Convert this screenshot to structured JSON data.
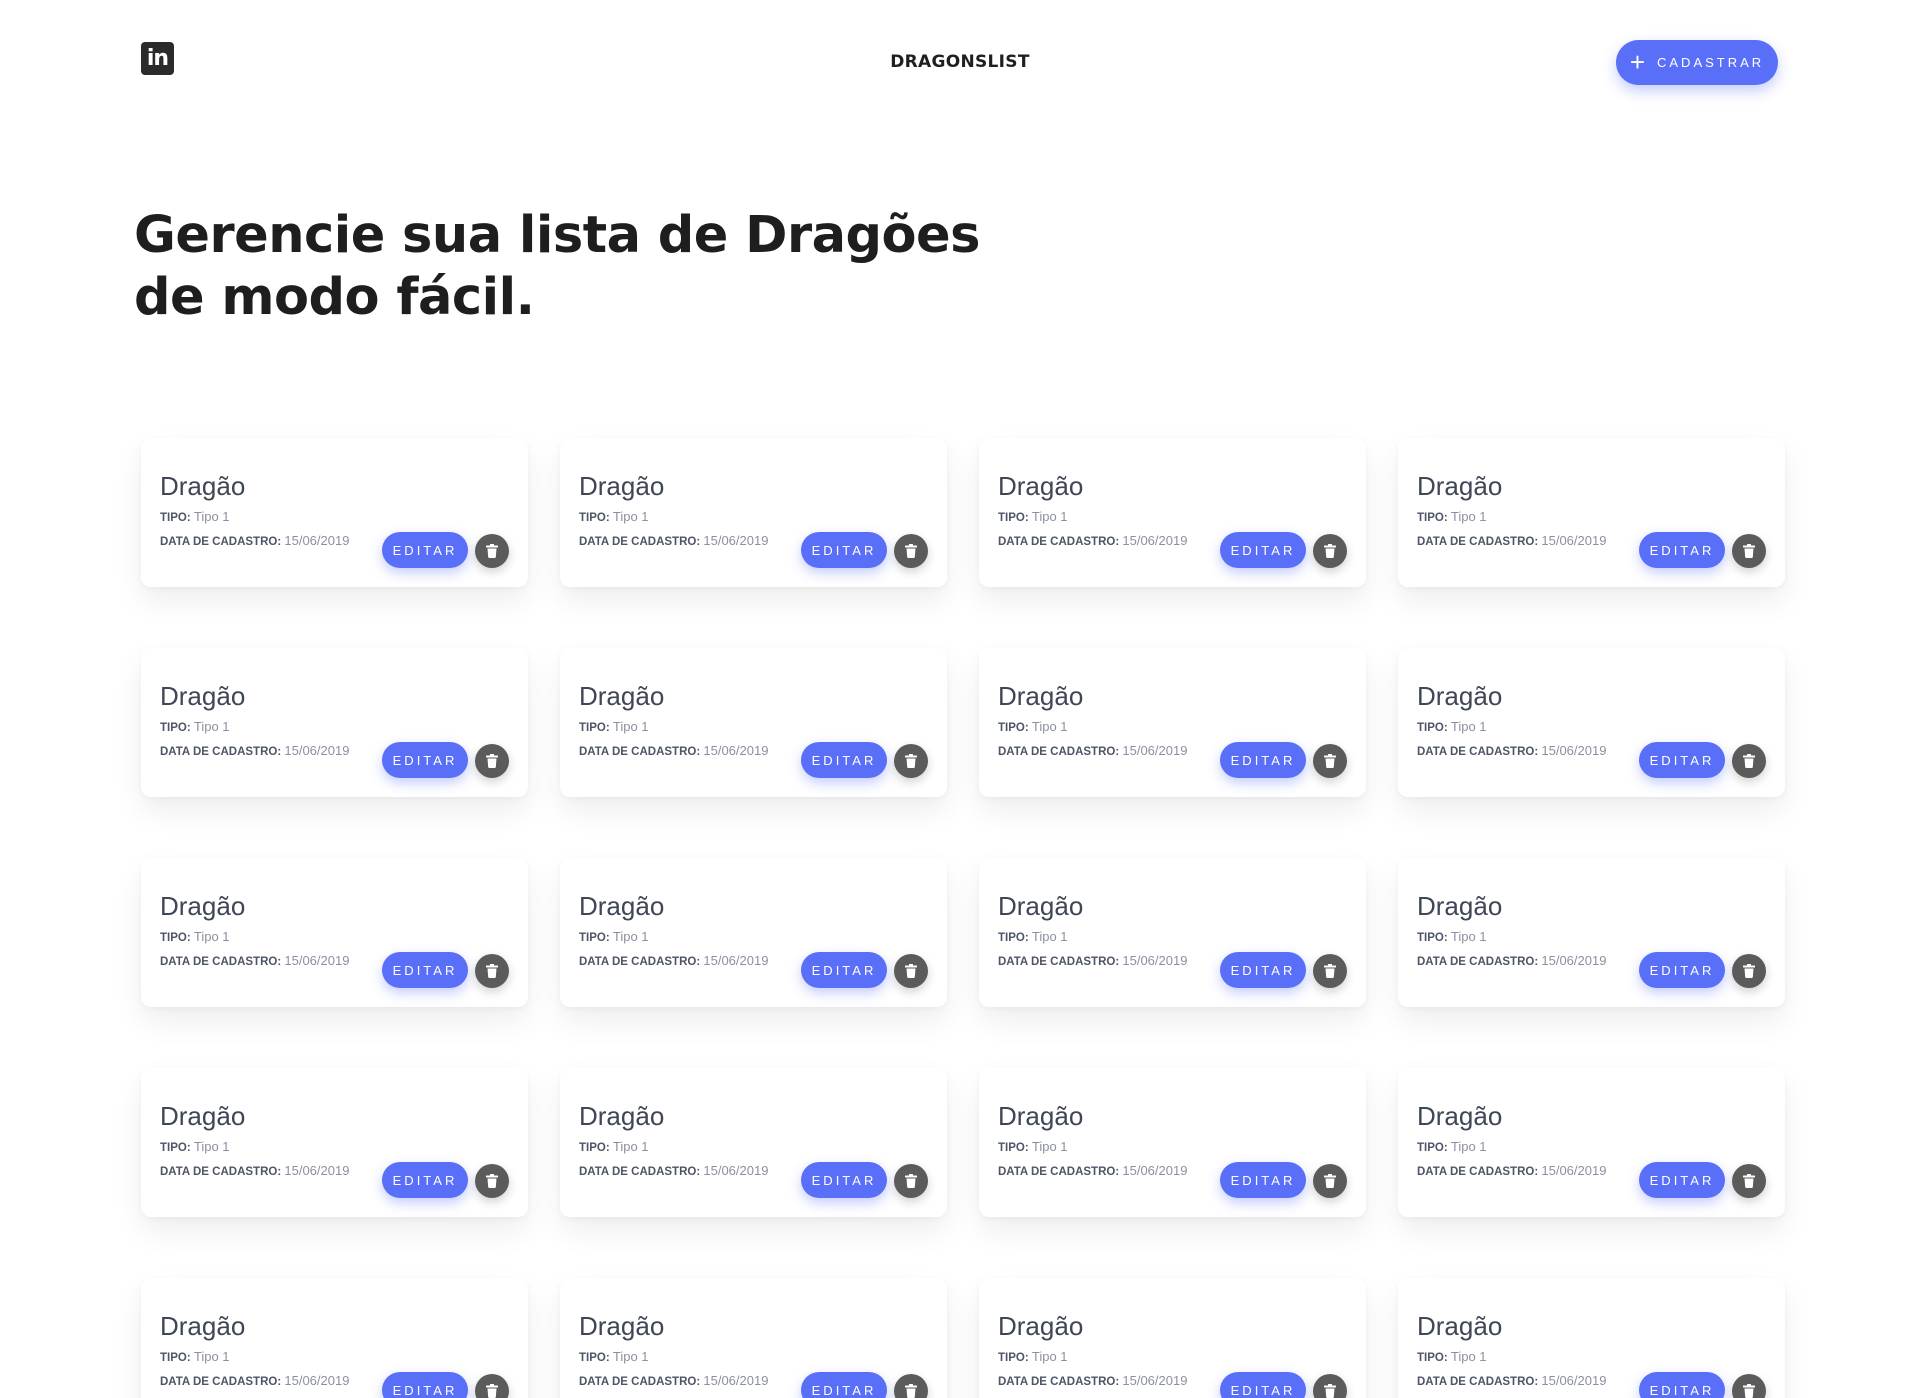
{
  "header": {
    "brand": "DRAGONSLIST",
    "social_icon": "linkedin-icon",
    "social_text": "in",
    "cta_icon": "plus-icon",
    "cta_label": "CADASTRAR"
  },
  "hero": {
    "title": "Gerencie sua lista de Dragões de modo fácil."
  },
  "card_labels": {
    "type_label": "TIPO:",
    "date_label": "DATA DE CADASTRO:",
    "edit_label": "EDITAR",
    "delete_icon": "trash-icon"
  },
  "dragons": [
    {
      "name": "Dragão",
      "type": "Tipo 1",
      "date": "15/06/2019"
    },
    {
      "name": "Dragão",
      "type": "Tipo 1",
      "date": "15/06/2019"
    },
    {
      "name": "Dragão",
      "type": "Tipo 1",
      "date": "15/06/2019"
    },
    {
      "name": "Dragão",
      "type": "Tipo 1",
      "date": "15/06/2019"
    },
    {
      "name": "Dragão",
      "type": "Tipo 1",
      "date": "15/06/2019"
    },
    {
      "name": "Dragão",
      "type": "Tipo 1",
      "date": "15/06/2019"
    },
    {
      "name": "Dragão",
      "type": "Tipo 1",
      "date": "15/06/2019"
    },
    {
      "name": "Dragão",
      "type": "Tipo 1",
      "date": "15/06/2019"
    },
    {
      "name": "Dragão",
      "type": "Tipo 1",
      "date": "15/06/2019"
    },
    {
      "name": "Dragão",
      "type": "Tipo 1",
      "date": "15/06/2019"
    },
    {
      "name": "Dragão",
      "type": "Tipo 1",
      "date": "15/06/2019"
    },
    {
      "name": "Dragão",
      "type": "Tipo 1",
      "date": "15/06/2019"
    },
    {
      "name": "Dragão",
      "type": "Tipo 1",
      "date": "15/06/2019"
    },
    {
      "name": "Dragão",
      "type": "Tipo 1",
      "date": "15/06/2019"
    },
    {
      "name": "Dragão",
      "type": "Tipo 1",
      "date": "15/06/2019"
    },
    {
      "name": "Dragão",
      "type": "Tipo 1",
      "date": "15/06/2019"
    },
    {
      "name": "Dragão",
      "type": "Tipo 1",
      "date": "15/06/2019"
    },
    {
      "name": "Dragão",
      "type": "Tipo 1",
      "date": "15/06/2019"
    },
    {
      "name": "Dragão",
      "type": "Tipo 1",
      "date": "15/06/2019"
    },
    {
      "name": "Dragão",
      "type": "Tipo 1",
      "date": "15/06/2019"
    }
  ],
  "colors": {
    "accent": "#5a6ff7",
    "delete_button": "#5b5b5b",
    "heading": "#1e1e1e",
    "card_title": "#3f4656"
  }
}
